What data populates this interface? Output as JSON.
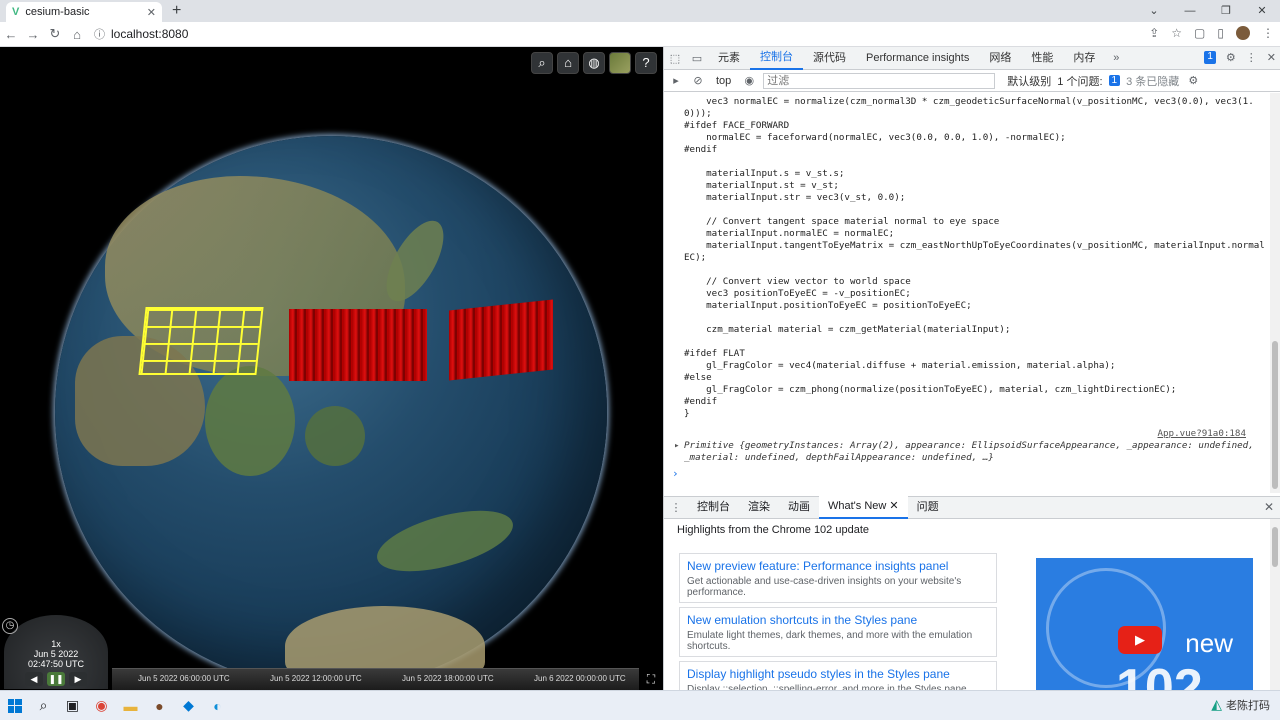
{
  "browser": {
    "tab_title": "cesium-basic",
    "new_tab": "+",
    "url": "localhost:8080"
  },
  "cesium": {
    "toolbar_icons": [
      "search-icon",
      "home-icon",
      "globe-icon",
      "layers-icon",
      "help-icon"
    ],
    "animation": {
      "speed": "1x",
      "date": "Jun 5 2022",
      "time": "02:47:50 UTC"
    },
    "timeline": {
      "ticks": [
        "Jun 5 2022 06:00:00 UTC",
        "Jun 5 2022 12:00:00 UTC",
        "Jun 5 2022 18:00:00 UTC",
        "Jun 6 2022 00:00:00 UTC"
      ]
    }
  },
  "devtools": {
    "tabs": [
      "元素",
      "控制台",
      "源代码",
      "Performance insights",
      "网络",
      "性能",
      "内存"
    ],
    "active_tab": "控制台",
    "issues_count": "1",
    "filter": {
      "context": "top",
      "placeholder": "过滤",
      "level": "默认级别",
      "issues": "1 个问题:",
      "issues_badge": "1",
      "hidden": "3 条已隐藏"
    },
    "console_code": "    vec3 normalEC = normalize(czm_normal3D * czm_geodeticSurfaceNormal(v_positionMC, vec3(0.0), vec3(1.0)));\n#ifdef FACE_FORWARD\n    normalEC = faceforward(normalEC, vec3(0.0, 0.0, 1.0), -normalEC);\n#endif\n\n    materialInput.s = v_st.s;\n    materialInput.st = v_st;\n    materialInput.str = vec3(v_st, 0.0);\n\n    // Convert tangent space material normal to eye space\n    materialInput.normalEC = normalEC;\n    materialInput.tangentToEyeMatrix = czm_eastNorthUpToEyeCoordinates(v_positionMC, materialInput.normalEC);\n\n    // Convert view vector to world space\n    vec3 positionToEyeEC = -v_positionEC;\n    materialInput.positionToEyeEC = positionToEyeEC;\n\n    czm_material material = czm_getMaterial(materialInput);\n\n#ifdef FLAT\n    gl_FragColor = vec4(material.diffuse + material.emission, material.alpha);\n#else\n    gl_FragColor = czm_phong(normalize(positionToEyeEC), material, czm_lightDirectionEC);\n#endif\n}",
    "source_link": "App.vue?91a0:184",
    "object_log": "Primitive {geometryInstances: Array(2), appearance: EllipsoidSurfaceAppearance, _appearance: undefined, _material: undefined, depthFailAppearance: undefined, …}",
    "drawer": {
      "tabs": [
        "控制台",
        "渲染",
        "动画",
        "What's New",
        "问题"
      ],
      "active": "What's New",
      "heading": "Highlights from the Chrome 102 update",
      "cards": [
        {
          "title": "New preview feature: Performance insights panel",
          "desc": "Get actionable and use-case-driven insights on your website's performance."
        },
        {
          "title": "New emulation shortcuts in the Styles pane",
          "desc": "Emulate light themes, dark themes, and more with the emulation shortcuts."
        },
        {
          "title": "Display highlight pseudo styles in the Styles pane",
          "desc": "Display ::selection, ::spelling-error, and more in the Styles pane."
        }
      ],
      "promo_new": "new",
      "promo_num": "102"
    }
  },
  "taskbar": {
    "brand": "老陈打码"
  },
  "colors": {
    "accent": "#1a73e8",
    "wall_red": "#e01010",
    "grid_yellow": "#ffff33"
  }
}
